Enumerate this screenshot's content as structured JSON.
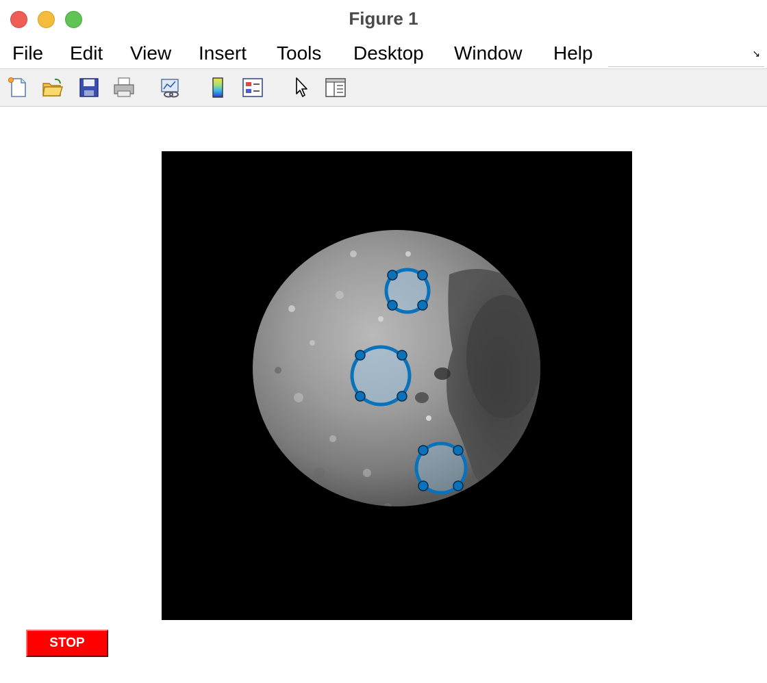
{
  "window": {
    "title": "Figure 1"
  },
  "menu": {
    "items": [
      {
        "label": "File"
      },
      {
        "label": "Edit"
      },
      {
        "label": "View"
      },
      {
        "label": "Insert"
      },
      {
        "label": "Tools"
      },
      {
        "label": "Desktop"
      },
      {
        "label": "Window"
      },
      {
        "label": "Help"
      }
    ]
  },
  "toolbar": {
    "icons": [
      "new-figure-icon",
      "open-file-icon",
      "save-icon",
      "print-icon",
      "link-plot-icon",
      "insert-colorbar-icon",
      "insert-legend-icon",
      "edit-plot-pointer-icon",
      "property-inspector-icon"
    ]
  },
  "figure": {
    "image": "moon-grayscale",
    "roi_color": "#0a72bb",
    "roi_fill": "#9ec8e8",
    "circles": [
      {
        "name": "roi-circle-top"
      },
      {
        "name": "roi-circle-middle"
      },
      {
        "name": "roi-circle-bottom"
      }
    ]
  },
  "controls": {
    "stop_label": "STOP",
    "stop_color": "#ff0000"
  }
}
